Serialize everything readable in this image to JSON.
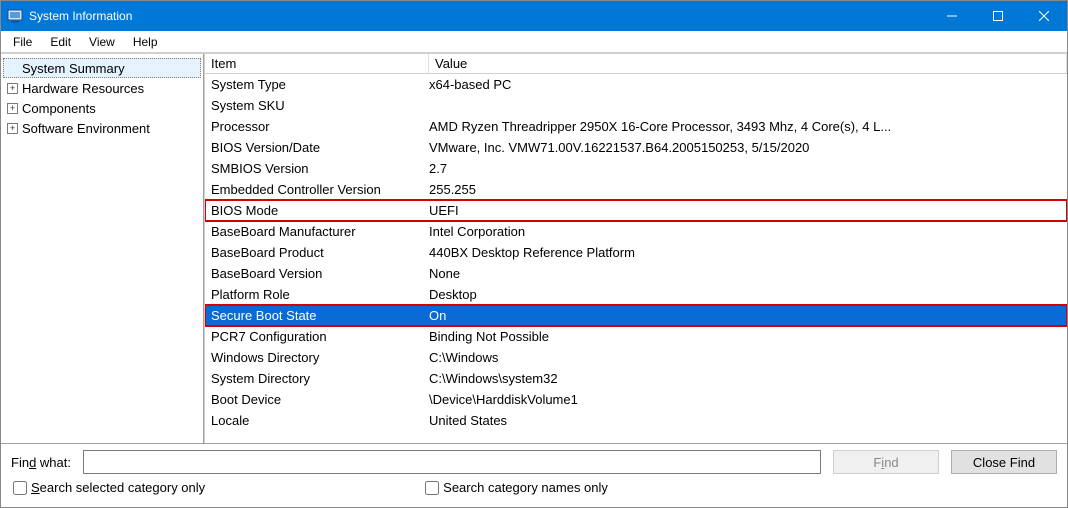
{
  "window": {
    "title": "System Information"
  },
  "menus": [
    "File",
    "Edit",
    "View",
    "Help"
  ],
  "tree": {
    "root": "System Summary",
    "children": [
      "Hardware Resources",
      "Components",
      "Software Environment"
    ]
  },
  "grid": {
    "headers": [
      "Item",
      "Value"
    ],
    "rows": [
      {
        "item": "System Type",
        "value": "x64-based PC"
      },
      {
        "item": "System SKU",
        "value": ""
      },
      {
        "item": "Processor",
        "value": "AMD Ryzen Threadripper 2950X 16-Core Processor, 3493 Mhz, 4 Core(s), 4 L..."
      },
      {
        "item": "BIOS Version/Date",
        "value": "VMware, Inc. VMW71.00V.16221537.B64.2005150253, 5/15/2020"
      },
      {
        "item": "SMBIOS Version",
        "value": "2.7"
      },
      {
        "item": "Embedded Controller Version",
        "value": "255.255"
      },
      {
        "item": "BIOS Mode",
        "value": "UEFI",
        "highlighted": true
      },
      {
        "item": "BaseBoard Manufacturer",
        "value": "Intel Corporation"
      },
      {
        "item": "BaseBoard Product",
        "value": "440BX Desktop Reference Platform"
      },
      {
        "item": "BaseBoard Version",
        "value": "None"
      },
      {
        "item": "Platform Role",
        "value": "Desktop"
      },
      {
        "item": "Secure Boot State",
        "value": "On",
        "selected": true,
        "highlighted": true
      },
      {
        "item": "PCR7 Configuration",
        "value": "Binding Not Possible"
      },
      {
        "item": "Windows Directory",
        "value": "C:\\Windows"
      },
      {
        "item": "System Directory",
        "value": "C:\\Windows\\system32"
      },
      {
        "item": "Boot Device",
        "value": "\\Device\\HarddiskVolume1"
      },
      {
        "item": "Locale",
        "value": "United States"
      }
    ]
  },
  "findbar": {
    "label_prefix": "Fin",
    "label_accel": "d",
    "label_suffix": " what:",
    "input_value": "",
    "find_btn_prefix": "F",
    "find_btn_accel": "i",
    "find_btn_suffix": "nd",
    "close_btn": "Close Find",
    "check1_accel": "S",
    "check1_rest": "earch selected category only",
    "check2_rest": "Search category names only"
  }
}
